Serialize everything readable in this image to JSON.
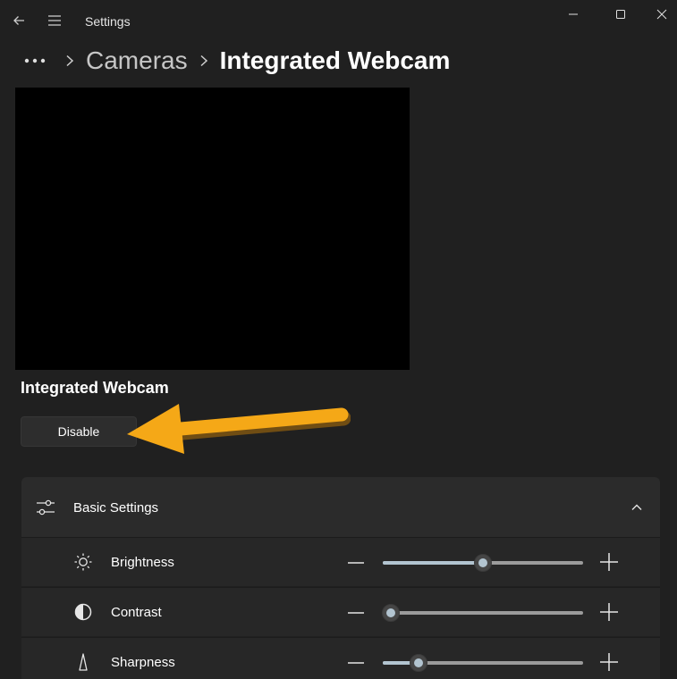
{
  "window": {
    "title": "Settings",
    "controls": [
      "minimize-icon",
      "maximize-icon",
      "close-icon"
    ]
  },
  "nav": {
    "back_icon": "back-arrow-icon",
    "menu_icon": "hamburger-menu-icon"
  },
  "breadcrumb": {
    "more_icon": "more-horizontal-icon",
    "parent": "Cameras",
    "current": "Integrated Webcam"
  },
  "camera": {
    "name": "Integrated Webcam",
    "disable_label": "Disable"
  },
  "annotation": {
    "arrow_color": "#f5a817"
  },
  "basic_settings": {
    "title": "Basic Settings",
    "icon": "sliders-icon",
    "expanded": true,
    "rows": [
      {
        "label": "Brightness",
        "icon": "sun-icon",
        "value": 0.5
      },
      {
        "label": "Contrast",
        "icon": "contrast-icon",
        "value": 0.04
      },
      {
        "label": "Sharpness",
        "icon": "triangle-icon",
        "value": 0.18
      }
    ]
  },
  "colors": {
    "background": "#202020",
    "card": "#2b2b2b",
    "row": "#272727",
    "slider_accent": "#b2c4d0"
  }
}
